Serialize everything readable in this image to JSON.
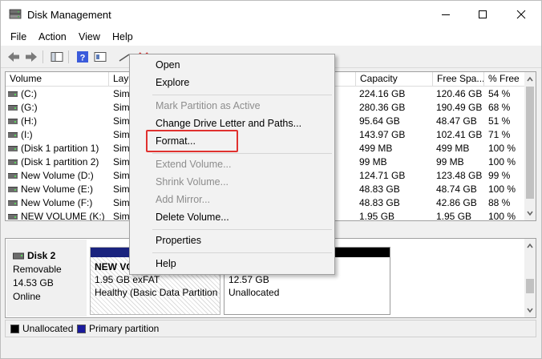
{
  "window": {
    "title": "Disk Management",
    "icons": {
      "app": "disk-management-icon",
      "minimize": "minimize-icon",
      "maximize": "maximize-icon",
      "close": "close-icon"
    }
  },
  "menubar": {
    "items": [
      "File",
      "Action",
      "View",
      "Help"
    ]
  },
  "toolbar": {
    "buttons": [
      "back-arrow-icon",
      "forward-arrow-icon",
      "console-tree-icon",
      "help-icon",
      "properties-icon",
      "connect-icon",
      "delete-icon",
      "new-icon",
      "folder-icon",
      "folder-icon",
      "list-view-icon"
    ]
  },
  "volume_list": {
    "columns": [
      "Volume",
      "Lay",
      "Capacity",
      "Free Spa...",
      "% Free"
    ],
    "rows": [
      {
        "volume": "(C:)",
        "layout": "Sim",
        "capacity": "224.16 GB",
        "free": "120.46 GB",
        "pct": "54 %"
      },
      {
        "volume": "(G:)",
        "layout": "Sim",
        "capacity": "280.36 GB",
        "free": "190.49 GB",
        "pct": "68 %"
      },
      {
        "volume": "(H:)",
        "layout": "Sim",
        "capacity": "95.64 GB",
        "free": "48.47 GB",
        "pct": "51 %"
      },
      {
        "volume": "(I:)",
        "layout": "Sim",
        "capacity": "143.97 GB",
        "free": "102.41 GB",
        "pct": "71 %"
      },
      {
        "volume": "(Disk 1 partition 1)",
        "layout": "Sim",
        "capacity": "499 MB",
        "free": "499 MB",
        "pct": "100 %"
      },
      {
        "volume": "(Disk 1 partition 2)",
        "layout": "Sim",
        "capacity": "99 MB",
        "free": "99 MB",
        "pct": "100 %"
      },
      {
        "volume": "New Volume (D:)",
        "layout": "Sim",
        "capacity": "124.71 GB",
        "free": "123.48 GB",
        "pct": "99 %"
      },
      {
        "volume": "New Volume (E:)",
        "layout": "Sim",
        "capacity": "48.83 GB",
        "free": "48.74 GB",
        "pct": "100 %"
      },
      {
        "volume": "New Volume (F:)",
        "layout": "Sim",
        "capacity": "48.83 GB",
        "free": "42.86 GB",
        "pct": "88 %"
      },
      {
        "volume": "NEW VOLUME (K:)",
        "layout": "Sim",
        "capacity": "1.95 GB",
        "free": "1.95 GB",
        "pct": "100 %"
      }
    ]
  },
  "disk_view": {
    "disk": {
      "name": "Disk 2",
      "type": "Removable",
      "size": "14.53 GB",
      "status": "Online"
    },
    "partitions": [
      {
        "name": "NEW VO",
        "detail": "1.95 GB exFAT",
        "status": "Healthy (Basic Data Partition",
        "bar_color": "#1a237e"
      },
      {
        "name": "",
        "detail": "12.57 GB",
        "status": "Unallocated",
        "bar_color": "#000000"
      }
    ]
  },
  "legend": {
    "items": [
      {
        "label": "Unallocated",
        "color": "#000000"
      },
      {
        "label": "Primary partition",
        "color": "#1a1a9c"
      }
    ]
  },
  "context_menu": {
    "open": "Open",
    "explore": "Explore",
    "mark_active": "Mark Partition as Active",
    "change_letter": "Change Drive Letter and Paths...",
    "format": "Format...",
    "extend": "Extend Volume...",
    "shrink": "Shrink Volume...",
    "add_mirror": "Add Mirror...",
    "delete": "Delete Volume...",
    "properties": "Properties",
    "help": "Help",
    "highlight_color": "#e0312f"
  }
}
